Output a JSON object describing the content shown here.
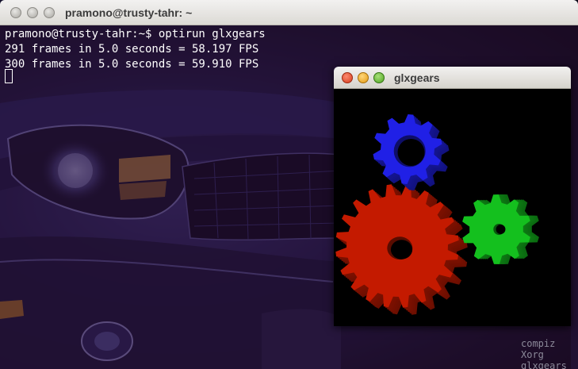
{
  "terminal": {
    "title": "pramono@trusty-tahr: ~",
    "lines": [
      "pramono@trusty-tahr:~$ optirun glxgears",
      "291 frames in 5.0 seconds = 58.197 FPS",
      "300 frames in 5.0 seconds = 59.910 FPS"
    ]
  },
  "glxgears": {
    "title": "glxgears",
    "gears": [
      {
        "name": "red-gear",
        "color": "#c41a00",
        "teeth": 20
      },
      {
        "name": "blue-gear",
        "color": "#2020e6",
        "teeth": 10
      },
      {
        "name": "green-gear",
        "color": "#14c01e",
        "teeth": 10
      }
    ]
  },
  "overlay": {
    "lines": [
      "compiz",
      "Xorg",
      "glxgears"
    ]
  },
  "colors": {
    "titlebar": "#e6e4e0",
    "terminal_text": "#ffffff",
    "close": "#e9512f",
    "minimize": "#f5b93a",
    "maximize": "#7ccb4c"
  }
}
